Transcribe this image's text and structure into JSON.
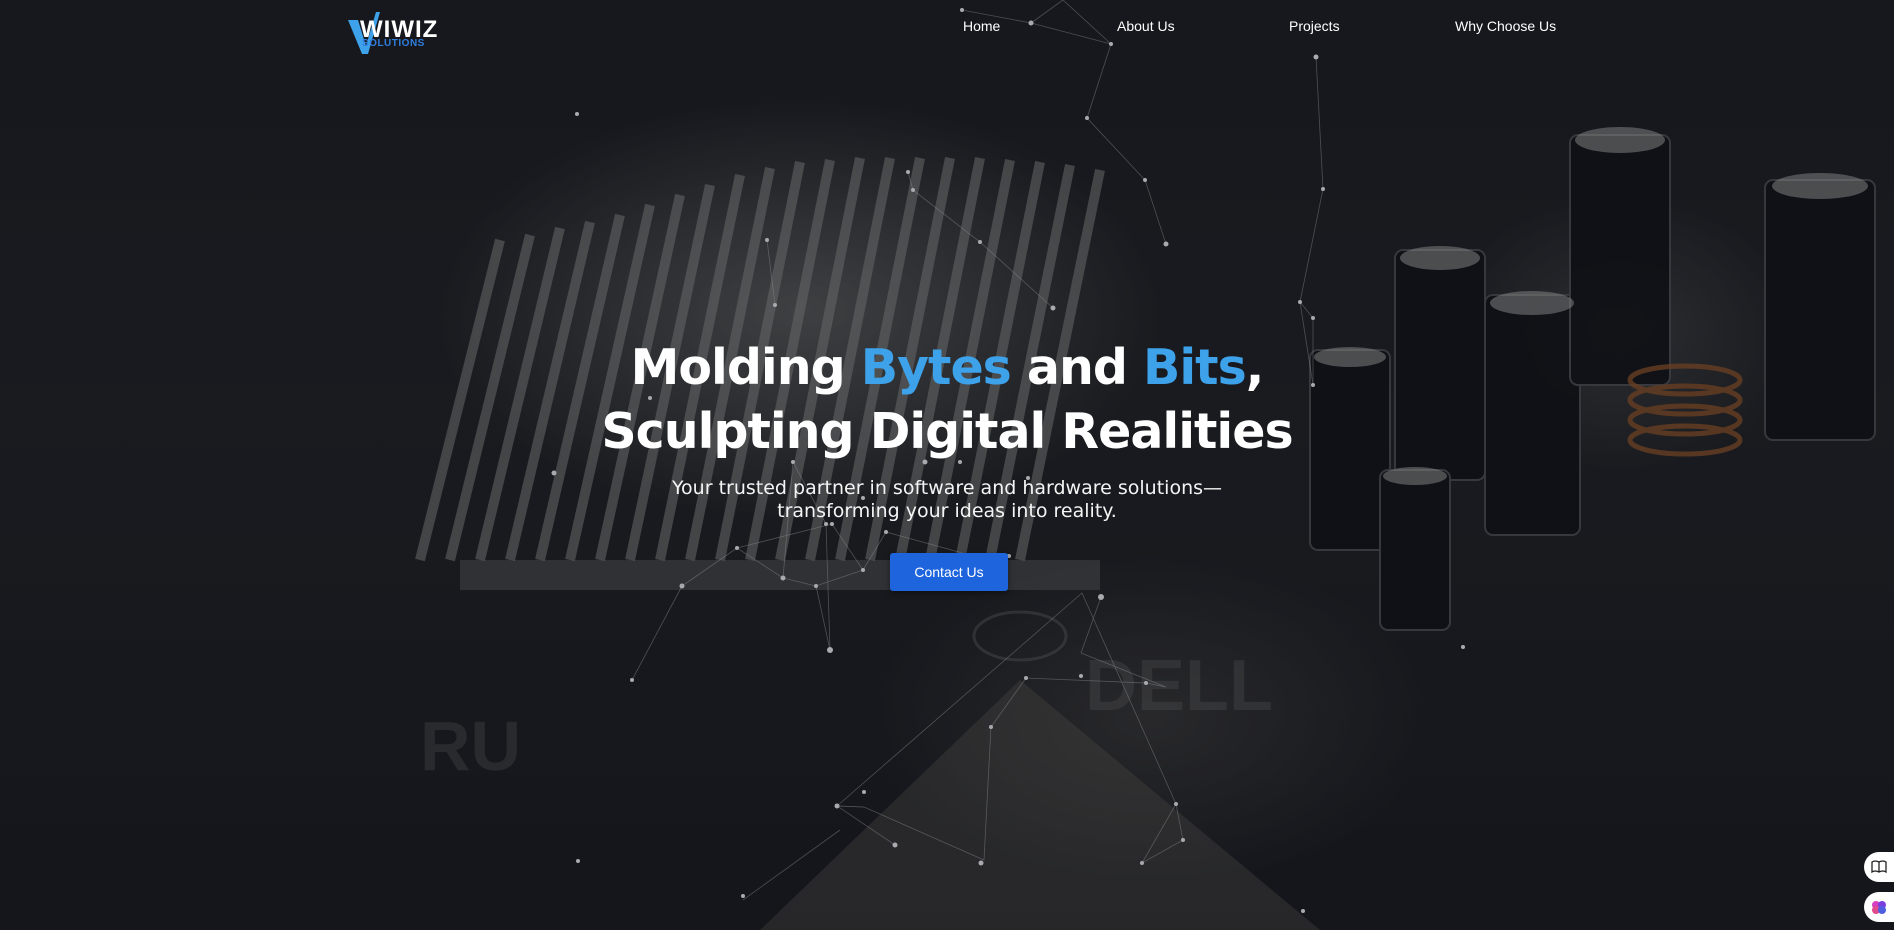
{
  "brand": {
    "name": "WIWIZ",
    "tagline": "SOLUTIONS",
    "colors": {
      "accent": "#3da2ea",
      "button": "#1e64dc",
      "logo_sub": "#2f7fe0"
    }
  },
  "nav": {
    "items": [
      {
        "label": "Home"
      },
      {
        "label": "About Us"
      },
      {
        "label": "Projects"
      },
      {
        "label": "Why Choose Us"
      }
    ]
  },
  "hero": {
    "title_part1": "Molding ",
    "title_hl1": "Bytes",
    "title_part2": " and ",
    "title_hl2": "Bits",
    "title_part3": ",",
    "title_line2": "Sculpting Digital Realities",
    "subtitle_line1": "Your trusted partner in software and hardware solutions—",
    "subtitle_line2": "transforming your ideas into reality.",
    "cta_label": "Contact Us"
  },
  "widgets": {
    "book_icon": "book-icon",
    "brain_icon": "brain-icon"
  }
}
